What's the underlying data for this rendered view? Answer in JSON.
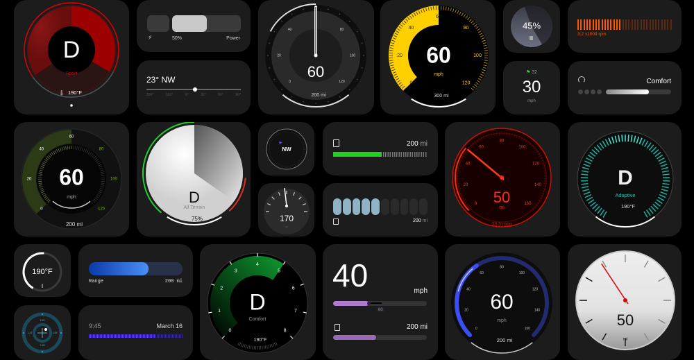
{
  "colors": {
    "background": "#000000",
    "card": "#1c1c1c",
    "sport_red": "#d40000",
    "yellow": "#ffd000",
    "rpm_orange": "#ff5a00",
    "green": "#20d020",
    "teal": "#2ec4b0",
    "purple": "#9a6ab8",
    "blue": "#3b4ef0",
    "range_blue": "#3a7ef0",
    "needle_red": "#e00000"
  },
  "sport_gauge": {
    "gear": "D",
    "mode": "Sport",
    "temp": "190°F",
    "icon": "coolant-icon"
  },
  "power_slider": {
    "icon": "bolt-icon",
    "value_label": "50%",
    "label": "Power",
    "level_percent": 50
  },
  "heading_slider": {
    "heading": "23° NW",
    "ticks": [
      "300°",
      "330°",
      "0°",
      "30°",
      "60°",
      "90°"
    ]
  },
  "gray_speedo": {
    "speed": "60",
    "range": "200 mi",
    "scale": [
      "0",
      "20",
      "40",
      "80",
      "100",
      "120"
    ],
    "icon": "fuel-icon"
  },
  "yellow_speedo": {
    "speed": "60",
    "unit": "mph",
    "range": "300 mi",
    "scale": [
      "0",
      "20",
      "40",
      "60",
      "80",
      "100",
      "120"
    ]
  },
  "fuel_percent": {
    "value": "45%",
    "icon": "fuel-icon"
  },
  "speed_small": {
    "speed": "30",
    "unit": "mph",
    "badge": "32",
    "badge_icon": "traffic-icon"
  },
  "rpm_bar": {
    "label": "3.2 x1000 rpm",
    "value": 3.2,
    "max": 8
  },
  "comfort_slider": {
    "icon": "gauge-icon",
    "mode": "Comfort",
    "level_percent": 55
  },
  "green_speedo": {
    "speed": "60",
    "unit": "mph",
    "range": "200 mi",
    "scale": [
      "0",
      "20",
      "40",
      "60",
      "80",
      "100",
      "120"
    ]
  },
  "terrain_gauge": {
    "gear": "D",
    "mode": "All Terrain",
    "fuel": "75%"
  },
  "compass_small": {
    "direction": "NW"
  },
  "odometer_small": {
    "value": "170",
    "unit": "mi"
  },
  "fuel_bar": {
    "range_value": "200",
    "range_unit": "mi",
    "level_percent": 50,
    "icon": "fuel-icon"
  },
  "fuel_segments": {
    "range_value": "200",
    "range_unit": "mi",
    "filled": 5,
    "total": 10
  },
  "red_gauge": {
    "value": "50",
    "unit": "mi",
    "economy": "33.5 mpg",
    "scale": [
      "0",
      "20",
      "40",
      "60",
      "80",
      "100",
      "120",
      "140",
      "160"
    ]
  },
  "adaptive_gauge": {
    "gear": "D",
    "mode": "Adaptive",
    "temp": "190°F"
  },
  "temp_ring": {
    "value": "190°F"
  },
  "range_bar": {
    "label": "Range",
    "value": "200 mi",
    "level_percent": 64
  },
  "crosshair": {
    "top": "1.50",
    "left": "1.47",
    "right": "1.39",
    "bottom": "1.28"
  },
  "date_bar": {
    "time": "9:45",
    "date": "March 16",
    "level_percent": 70
  },
  "comfort_gauge": {
    "gear": "D",
    "mode": "Comfort",
    "temp": "190°F",
    "scale": [
      "0",
      "1",
      "2",
      "3",
      "4",
      "5",
      "6",
      "7",
      "8"
    ]
  },
  "speed_slider": {
    "speed": "40",
    "unit": "mph",
    "limit": "60",
    "range": "200 mi",
    "speed_level_percent": 38,
    "fuel_level_percent": 46
  },
  "blue_speedo": {
    "speed": "60",
    "unit": "mph",
    "range": "200 mi",
    "scale": [
      "0",
      "20",
      "40",
      "60",
      "80",
      "100",
      "120",
      "140",
      "160"
    ]
  },
  "white_gauge": {
    "value": "50",
    "unit": "mi"
  }
}
